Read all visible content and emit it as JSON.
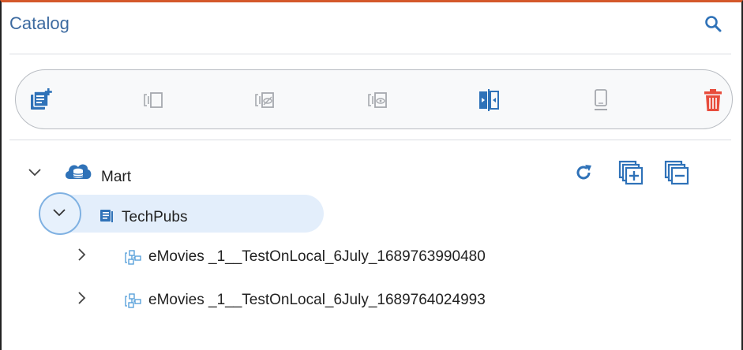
{
  "panel": {
    "title": "Catalog",
    "search_icon": "search-icon"
  },
  "toolbar": {
    "buttons": [
      {
        "icon": "add-catalog-icon"
      },
      {
        "icon": "column-icon"
      },
      {
        "icon": "hidden-column-icon"
      },
      {
        "icon": "view-column-icon"
      },
      {
        "icon": "split-compare-icon"
      },
      {
        "icon": "mobile-device-icon"
      },
      {
        "icon": "trash-icon"
      }
    ]
  },
  "tree": {
    "root": {
      "label": "Mart",
      "icon": "cloud-database-icon",
      "expanded": true,
      "actions": [
        "refresh-icon",
        "expand-all-icon",
        "collapse-all-icon"
      ]
    },
    "library": {
      "label": "TechPubs",
      "icon": "library-icon",
      "expanded": true,
      "selected": true
    },
    "models": [
      {
        "label": "eMovies _1__TestOnLocal_6July_1689763990480",
        "icon": "model-icon"
      },
      {
        "label": "eMovies _1__TestOnLocal_6July_1689764024993",
        "icon": "model-icon"
      }
    ]
  },
  "colors": {
    "accent": "#2f72b8",
    "title": "#3c6aa0",
    "disabled": "#a6a9ae",
    "danger": "#e74c3c",
    "selection": "#e3eefb",
    "border_top": "#d4582a"
  }
}
